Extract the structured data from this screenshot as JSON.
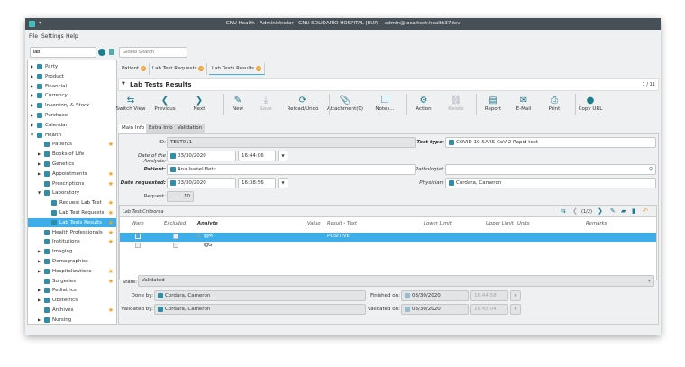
{
  "window": {
    "title": "GNU Health - Administrator - GNU SOLIDARIO HOSPITAL [EUR] - admin@localhost:health37dev"
  },
  "menu": [
    "File",
    "Settings",
    "Help"
  ],
  "search": {
    "value": "lab",
    "global_placeholder": "Global Search"
  },
  "sidebar": [
    {
      "label": "Party",
      "level": 0,
      "arrow": "right",
      "star": false
    },
    {
      "label": "Product",
      "level": 0,
      "arrow": "right",
      "star": false
    },
    {
      "label": "Financial",
      "level": 0,
      "arrow": "right",
      "star": false
    },
    {
      "label": "Currency",
      "level": 0,
      "arrow": "right",
      "star": false
    },
    {
      "label": "Inventory & Stock",
      "level": 0,
      "arrow": "right",
      "star": false
    },
    {
      "label": "Purchase",
      "level": 0,
      "arrow": "right",
      "star": false
    },
    {
      "label": "Calendar",
      "level": 0,
      "arrow": "right",
      "star": false
    },
    {
      "label": "Health",
      "level": 0,
      "arrow": "down",
      "star": false
    },
    {
      "label": "Patients",
      "level": 1,
      "arrow": "",
      "star": true
    },
    {
      "label": "Books of Life",
      "level": 1,
      "arrow": "right",
      "star": false
    },
    {
      "label": "Genetics",
      "level": 1,
      "arrow": "right",
      "star": false
    },
    {
      "label": "Appointments",
      "level": 1,
      "arrow": "right",
      "star": true
    },
    {
      "label": "Prescriptions",
      "level": 1,
      "arrow": "",
      "star": true
    },
    {
      "label": "Laboratory",
      "level": 1,
      "arrow": "down",
      "star": false
    },
    {
      "label": "Request Lab Test",
      "level": 2,
      "arrow": "",
      "star": true
    },
    {
      "label": "Lab Test Requests",
      "level": 2,
      "arrow": "",
      "star": true
    },
    {
      "label": "Lab Tests Results",
      "level": 2,
      "arrow": "",
      "star": true,
      "selected": true
    },
    {
      "label": "Health Professionals",
      "level": 1,
      "arrow": "",
      "star": true
    },
    {
      "label": "Institutions",
      "level": 1,
      "arrow": "",
      "star": true
    },
    {
      "label": "Imaging",
      "level": 1,
      "arrow": "right",
      "star": false
    },
    {
      "label": "Demographics",
      "level": 1,
      "arrow": "right",
      "star": false
    },
    {
      "label": "Hospitalizations",
      "level": 1,
      "arrow": "right",
      "star": true
    },
    {
      "label": "Surgeries",
      "level": 1,
      "arrow": "",
      "star": true
    },
    {
      "label": "Pediatrics",
      "level": 1,
      "arrow": "right",
      "star": false
    },
    {
      "label": "Obstetrics",
      "level": 1,
      "arrow": "right",
      "star": false
    },
    {
      "label": "Archives",
      "level": 1,
      "arrow": "",
      "star": true
    },
    {
      "label": "Nursing",
      "level": 1,
      "arrow": "right",
      "star": false
    }
  ],
  "tabs": [
    "Patient",
    "Lab Test Requests",
    "Lab Tests Results"
  ],
  "header": {
    "title": "Lab Tests Results",
    "counter": "1 / 11"
  },
  "toolbar": [
    {
      "label": "Switch View",
      "glyph": "⇆",
      "dis": false
    },
    {
      "label": "Previous",
      "glyph": "❮",
      "dis": false
    },
    {
      "label": "Next",
      "glyph": "❯",
      "dis": false
    },
    {
      "label": "New",
      "glyph": "✎",
      "dis": false
    },
    {
      "label": "Save",
      "glyph": "⤓",
      "dis": true
    },
    {
      "label": "Reload/Undo",
      "glyph": "⟳",
      "dis": false
    },
    {
      "label": "Attachment(0)",
      "glyph": "📎",
      "dis": false
    },
    {
      "label": "Notes...",
      "glyph": "❐",
      "dis": false
    },
    {
      "label": "Action",
      "glyph": "⚙",
      "dis": false
    },
    {
      "label": "Relate",
      "glyph": "⛓",
      "dis": true
    },
    {
      "label": "Report",
      "glyph": "▤",
      "dis": false
    },
    {
      "label": "E-Mail",
      "glyph": "✉",
      "dis": false
    },
    {
      "label": "Print",
      "glyph": "⎙",
      "dis": false
    },
    {
      "label": "Copy URL",
      "glyph": "●",
      "dis": false
    }
  ],
  "form_tabs": [
    "Main Info",
    "Extra Info",
    "Validation"
  ],
  "form": {
    "id_label": "ID:",
    "id": "TEST011",
    "test_type_label": "Test type:",
    "test_type": "COVID-19 SARS-CoV-2 Rapid test",
    "analysis_label": "Date of the Analysis:",
    "analysis_date": "03/30/2020",
    "analysis_time": "16:44:06",
    "patient_label": "Patient:",
    "patient": "Ana Isabel Betz",
    "pathologist_label": "Pathologist:",
    "pathologist": "",
    "requested_label": "Date requested:",
    "requested_date": "03/30/2020",
    "requested_time": "16:38:56",
    "physician_label": "Physician:",
    "physician": "Cordara, Cameron",
    "request_label": "Request:",
    "request": "10"
  },
  "criteria": {
    "title": "Lab Test Criteorea",
    "pager": "(1/2)",
    "columns": [
      "Warn",
      "Excluded",
      "Analyte",
      "Value",
      "Result - Text",
      "Lower Limit",
      "Upper Limit",
      "Units",
      "Remarks"
    ],
    "rows": [
      {
        "analyte": "IgM",
        "result": "POSITIVE",
        "warn_icon": true
      },
      {
        "analyte": "IgG",
        "result": "",
        "warn_icon": false
      }
    ]
  },
  "footer": {
    "state_label": "State:",
    "state": "Validated",
    "done_label": "Done by:",
    "done": "Cordara, Cameron",
    "finished_label": "Finished on:",
    "finished_date": "03/30/2020",
    "finished_time": "16:44:58",
    "validated_label": "Validated by:",
    "validated": "Cordara, Cameron",
    "validated_on_label": "Validated on:",
    "validated_date": "03/30/2020",
    "validated_time": "16:45:04"
  }
}
